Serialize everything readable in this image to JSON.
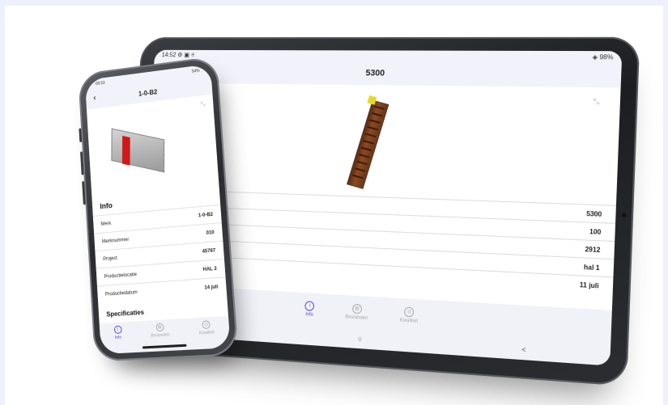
{
  "tablet": {
    "status_time": "14:52",
    "status_icons": "⚙ ▣ ⍟",
    "status_right": "◈ 98%",
    "title": "5300",
    "rows": [
      "5300",
      "100",
      "2912",
      "hal 1",
      "11 juli"
    ],
    "tabs": [
      {
        "label": "Info",
        "icon": "i"
      },
      {
        "label": "Bestanden",
        "icon": "▤"
      },
      {
        "label": "Kwaliteit",
        "icon": "◎"
      }
    ],
    "nav": {
      "recents": "|||",
      "home": "○",
      "back": "<"
    },
    "colors": {
      "accent": "#4b4bd6",
      "header_bg": "#f2f2fa",
      "model": "#8a4a22"
    }
  },
  "phone": {
    "status_time": "09:53",
    "status_right": "54%",
    "back": "‹",
    "title": "1-0-B2",
    "info_title": "Info",
    "rows": [
      {
        "label": "Merk",
        "value": "1-0-B2"
      },
      {
        "label": "Merknummer",
        "value": "010"
      },
      {
        "label": "Project",
        "value": "45767"
      },
      {
        "label": "Productielocatie",
        "value": "HAL 2"
      },
      {
        "label": "Productiedatum",
        "value": "14 juli"
      }
    ],
    "specs_title": "Specificaties",
    "tabs": [
      {
        "label": "Info",
        "icon": "i"
      },
      {
        "label": "Bestanden",
        "icon": "▤"
      },
      {
        "label": "Kwaliteit",
        "icon": "◎"
      }
    ]
  },
  "icons": {
    "expand": "⤡"
  }
}
